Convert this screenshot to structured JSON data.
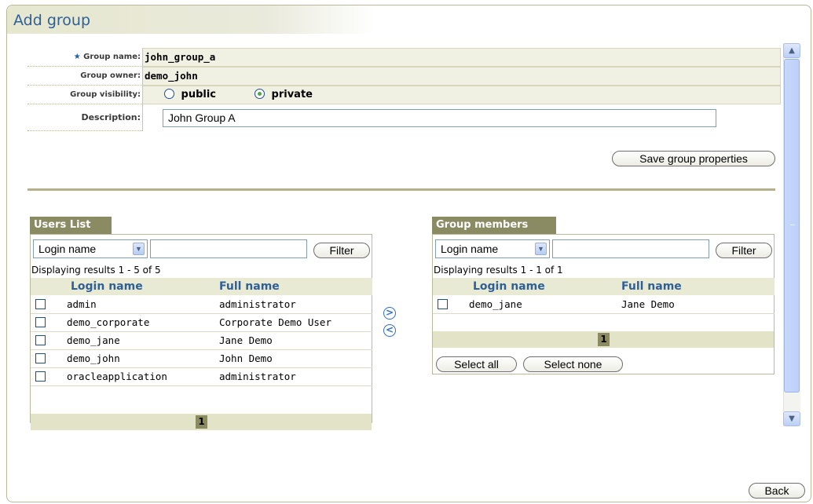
{
  "header": {
    "title": "Add group"
  },
  "form": {
    "group_name_label": "Group name:",
    "group_name_value": "john_group_a",
    "group_owner_label": "Group owner:",
    "group_owner_value": "demo_john",
    "visibility_label": "Group visibility:",
    "visibility_options": [
      {
        "label": "public",
        "selected": false
      },
      {
        "label": "private",
        "selected": true
      }
    ],
    "description_label": "Description:",
    "description_value": "John Group A",
    "save_label": "Save group properties"
  },
  "users_list": {
    "title": "Users List",
    "filter_select": "Login name",
    "filter_value": "",
    "filter_button": "Filter",
    "results_text": "Displaying results 1 - 5 of 5",
    "columns": [
      "Login name",
      "Full name"
    ],
    "rows": [
      {
        "login": "admin",
        "full": "administrator"
      },
      {
        "login": "demo_corporate",
        "full": "Corporate Demo User"
      },
      {
        "login": "demo_jane",
        "full": "Jane Demo"
      },
      {
        "login": "demo_john",
        "full": "John Demo"
      },
      {
        "login": "oracleapplication",
        "full": "administrator"
      }
    ],
    "page": "1"
  },
  "move": {
    "add_icon": "chevron-right-circle-icon",
    "remove_icon": "chevron-left-circle-icon"
  },
  "group_members": {
    "title": "Group members",
    "filter_select": "Login name",
    "filter_value": "",
    "filter_button": "Filter",
    "results_text": "Displaying results 1 - 1 of 1",
    "columns": [
      "Login name",
      "Full name"
    ],
    "rows": [
      {
        "login": "demo_jane",
        "full": "Jane Demo"
      }
    ],
    "page": "1",
    "select_all": "Select all",
    "select_none": "Select none"
  },
  "footer": {
    "back_label": "Back"
  },
  "colors": {
    "title_blue": "#2f5f99",
    "panel_tab": "#8a8a63",
    "header_band": "#e9ead3"
  }
}
